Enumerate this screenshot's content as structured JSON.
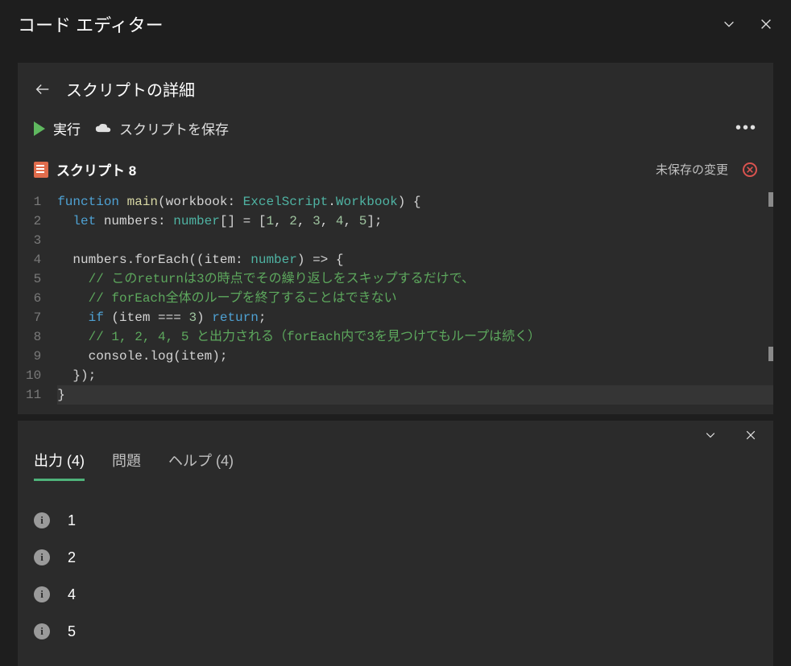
{
  "header": {
    "title": "コード エディター"
  },
  "subheader": {
    "title": "スクリプトの詳細"
  },
  "toolbar": {
    "run_label": "実行",
    "save_label": "スクリプトを保存"
  },
  "script": {
    "name": "スクリプト 8",
    "unsaved_label": "未保存の変更"
  },
  "code": {
    "lines": [
      [
        {
          "t": "kw",
          "v": "function"
        },
        {
          "t": "plain",
          "v": " "
        },
        {
          "t": "fn",
          "v": "main"
        },
        {
          "t": "plain",
          "v": "(workbook: "
        },
        {
          "t": "type",
          "v": "ExcelScript"
        },
        {
          "t": "plain",
          "v": "."
        },
        {
          "t": "type",
          "v": "Workbook"
        },
        {
          "t": "plain",
          "v": ") {"
        }
      ],
      [
        {
          "t": "plain",
          "v": "  "
        },
        {
          "t": "kw",
          "v": "let"
        },
        {
          "t": "plain",
          "v": " numbers: "
        },
        {
          "t": "type",
          "v": "number"
        },
        {
          "t": "plain",
          "v": "[] = ["
        },
        {
          "t": "num",
          "v": "1"
        },
        {
          "t": "plain",
          "v": ", "
        },
        {
          "t": "num",
          "v": "2"
        },
        {
          "t": "plain",
          "v": ", "
        },
        {
          "t": "num",
          "v": "3"
        },
        {
          "t": "plain",
          "v": ", "
        },
        {
          "t": "num",
          "v": "4"
        },
        {
          "t": "plain",
          "v": ", "
        },
        {
          "t": "num",
          "v": "5"
        },
        {
          "t": "plain",
          "v": "];"
        }
      ],
      [],
      [
        {
          "t": "plain",
          "v": "  numbers.forEach((item: "
        },
        {
          "t": "type",
          "v": "number"
        },
        {
          "t": "plain",
          "v": ") => {"
        }
      ],
      [
        {
          "t": "plain",
          "v": "    "
        },
        {
          "t": "cmt",
          "v": "// このreturnは3の時点でその繰り返しをスキップするだけで、"
        }
      ],
      [
        {
          "t": "plain",
          "v": "    "
        },
        {
          "t": "cmt",
          "v": "// forEach全体のループを終了することはできない"
        }
      ],
      [
        {
          "t": "plain",
          "v": "    "
        },
        {
          "t": "kw",
          "v": "if"
        },
        {
          "t": "plain",
          "v": " (item === "
        },
        {
          "t": "num",
          "v": "3"
        },
        {
          "t": "plain",
          "v": ") "
        },
        {
          "t": "kw",
          "v": "return"
        },
        {
          "t": "plain",
          "v": ";"
        }
      ],
      [
        {
          "t": "plain",
          "v": "    "
        },
        {
          "t": "cmt",
          "v": "// 1, 2, 4, 5 と出力される（forEach内で3を見つけてもループは続く）"
        }
      ],
      [
        {
          "t": "plain",
          "v": "    console.log(item);"
        }
      ],
      [
        {
          "t": "plain",
          "v": "  });"
        }
      ],
      [
        {
          "t": "plain",
          "v": "}"
        }
      ]
    ],
    "cursor_line": 11
  },
  "tabs": {
    "output": "出力",
    "output_count": 4,
    "problems": "問題",
    "help": "ヘルプ",
    "help_count": 4
  },
  "output": [
    "1",
    "2",
    "4",
    "5"
  ]
}
